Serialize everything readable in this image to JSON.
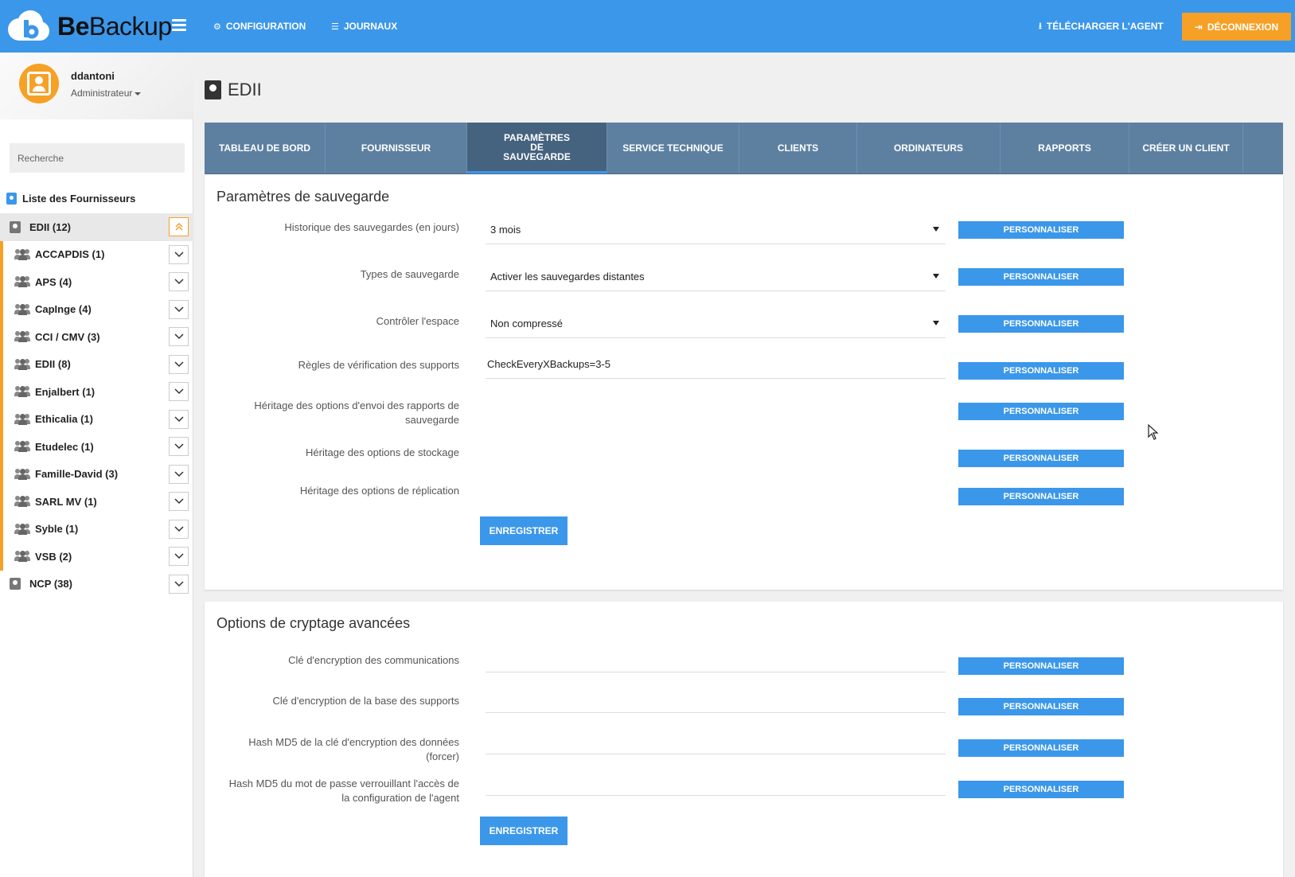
{
  "brand": {
    "name_bold": "Be",
    "name_rest": "Backup"
  },
  "header": {
    "nav_config": "CONFIGURATION",
    "nav_journaux": "JOURNAUX",
    "download_agent": "TÉLÉCHARGER L'AGENT",
    "logout": "DÉCONNEXION",
    "accent_color": "#3b97ea",
    "logout_color": "#f7a026"
  },
  "user": {
    "name": "ddantoni",
    "role": "Administrateur"
  },
  "search": {
    "placeholder": "Recherche"
  },
  "sidebar": {
    "list_title": "Liste des Fournisseurs",
    "items": [
      {
        "label": "EDII (12)",
        "level": "top",
        "active": true,
        "expanded": true
      },
      {
        "label": "ACCAPDIS (1)",
        "level": "child"
      },
      {
        "label": "APS (4)",
        "level": "child"
      },
      {
        "label": "CapInge (4)",
        "level": "child"
      },
      {
        "label": "CCI / CMV (3)",
        "level": "child"
      },
      {
        "label": "EDII (8)",
        "level": "child"
      },
      {
        "label": "Enjalbert (1)",
        "level": "child"
      },
      {
        "label": "Ethicalia (1)",
        "level": "child"
      },
      {
        "label": "Etudelec (1)",
        "level": "child"
      },
      {
        "label": "Famille-David (3)",
        "level": "child"
      },
      {
        "label": "SARL MV (1)",
        "level": "child"
      },
      {
        "label": "Syble (1)",
        "level": "child"
      },
      {
        "label": "VSB (2)",
        "level": "child"
      },
      {
        "label": "NCP (38)",
        "level": "top"
      }
    ]
  },
  "page": {
    "title": "EDII"
  },
  "tabs": [
    {
      "label": "TABLEAU DE BORD"
    },
    {
      "label": "FOURNISSEUR"
    },
    {
      "label": "PARAMÈTRES DE SAUVEGARDE",
      "active": true
    },
    {
      "label": "SERVICE TECHNIQUE"
    },
    {
      "label": "CLIENTS"
    },
    {
      "label": "ORDINATEURS"
    },
    {
      "label": "RAPPORTS"
    },
    {
      "label": "CRÉER UN CLIENT"
    }
  ],
  "backup_settings": {
    "title": "Paramètres de sauvegarde",
    "history_label": "Historique des sauvegardes (en jours)",
    "history_value": "3 mois",
    "types_label": "Types de sauvegarde",
    "types_value": "Activer les sauvegardes distantes",
    "space_label": "Contrôler l'espace",
    "space_value": "Non compressé",
    "rules_label": "Règles de vérification des supports",
    "rules_value": "CheckEveryXBackups=3-5",
    "reports_label": "Héritage des options d'envoi des rapports de sauvegarde",
    "storage_label": "Héritage des options de stockage",
    "replication_label": "Héritage des options de réplication",
    "customize": "PERSONNALISER",
    "save": "ENREGISTRER"
  },
  "encryption": {
    "title": "Options de cryptage avancées",
    "comm_key_label": "Clé d'encryption des communications",
    "db_key_label": "Clé d'encryption de la base des supports",
    "md5_data_label": "Hash MD5 de la clé d'encryption des données (forcer)",
    "md5_agent_label": "Hash MD5 du mot de passe verrouillant l'accès de la configuration de l'agent",
    "customize": "PERSONNALISER",
    "save": "ENREGISTRER"
  }
}
